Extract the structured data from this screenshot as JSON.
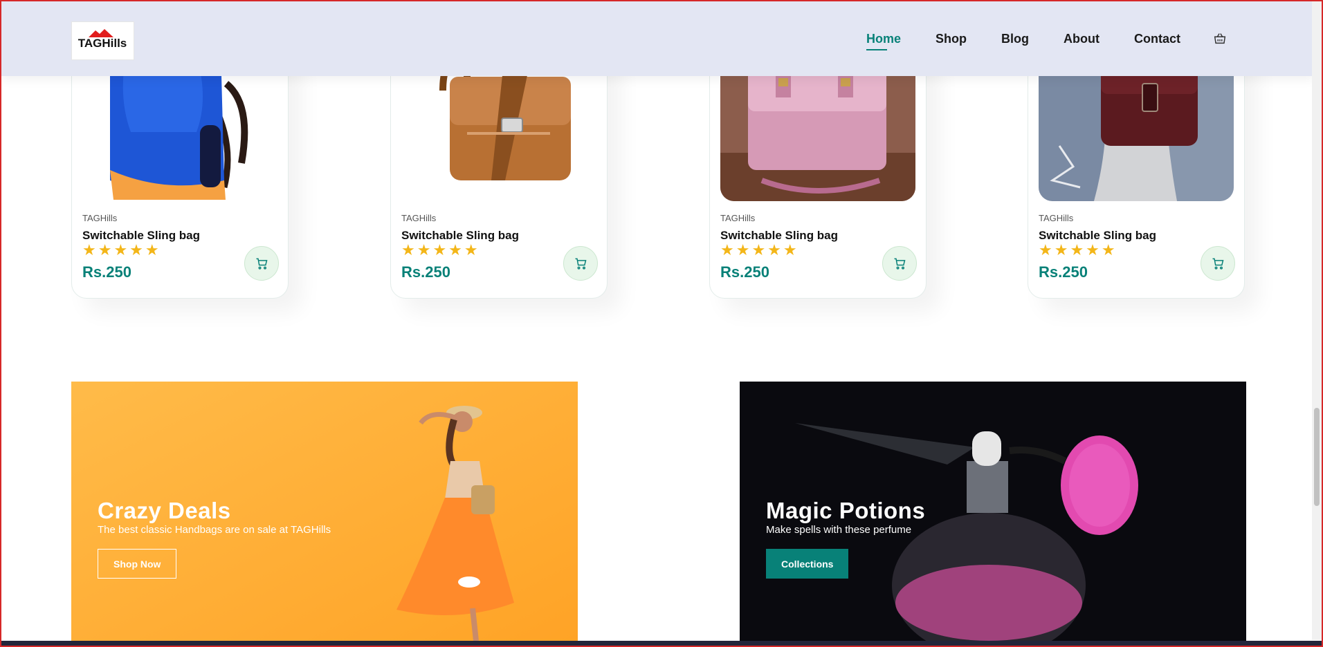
{
  "brand": {
    "logo_text": "TAGHills"
  },
  "nav": {
    "items": [
      "Home",
      "Shop",
      "Blog",
      "About",
      "Contact"
    ],
    "active": "Home",
    "cart_icon": "cart-icon"
  },
  "products": [
    {
      "brand": "TAGHills",
      "title": "Switchable Sling bag",
      "rating": 5,
      "stars": "★★★★★",
      "price": "Rs.250",
      "image": "blue-backpack"
    },
    {
      "brand": "TAGHills",
      "title": "Switchable Sling bag",
      "rating": 5,
      "stars": "★★★★★",
      "price": "Rs.250",
      "image": "tan-leather-bag"
    },
    {
      "brand": "TAGHills",
      "title": "Switchable Sling bag",
      "rating": 5,
      "stars": "★★★★★",
      "price": "Rs.250",
      "image": "pink-satchel"
    },
    {
      "brand": "TAGHills",
      "title": "Switchable Sling bag",
      "rating": 5,
      "stars": "★★★★★",
      "price": "Rs.250",
      "image": "maroon-crossbody-bag"
    }
  ],
  "banners": [
    {
      "title": "Crazy Deals",
      "text": "The best classic Handbags are on sale at TAGHills",
      "button": "Shop Now"
    },
    {
      "title": "Magic Potions",
      "text": "Make spells with these perfume",
      "button": "Collections"
    }
  ],
  "colors": {
    "accent": "#088178",
    "header_bg": "#e3e6f3",
    "star": "#f3b619",
    "banner1_bg": "#ffb13b",
    "banner2_bg": "#0a0a0f"
  }
}
